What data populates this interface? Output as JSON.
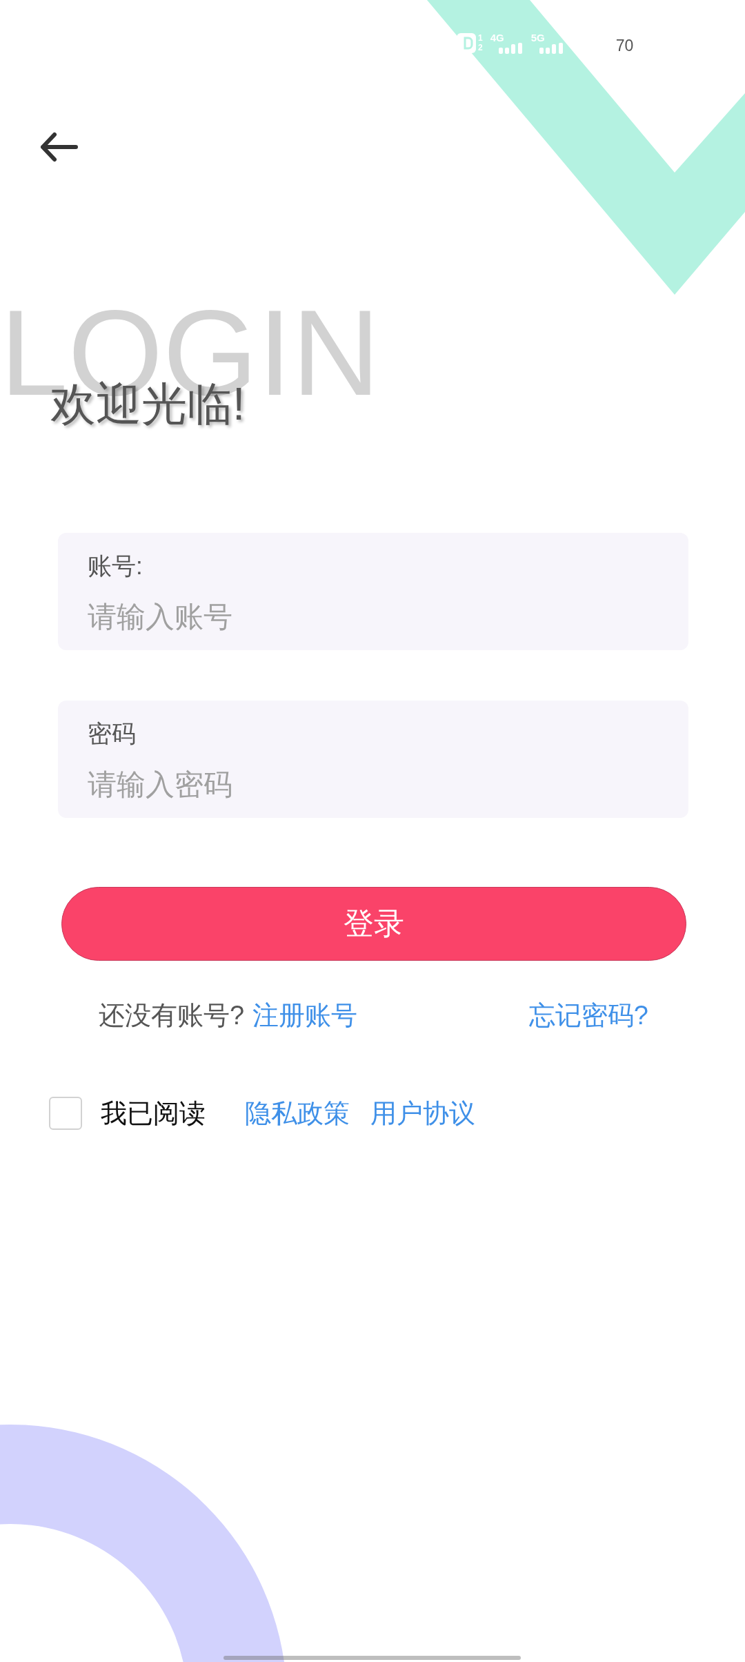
{
  "status_bar": {
    "sim_slots": [
      "1",
      "2"
    ],
    "networks": [
      {
        "label": "4G"
      },
      {
        "label": "5G"
      }
    ],
    "battery": "70"
  },
  "header": {
    "watermark": "LOGIN",
    "title": "欢迎光临!"
  },
  "form": {
    "fields": [
      {
        "label": "账号:",
        "placeholder": "请输入账号"
      },
      {
        "label": "密码",
        "placeholder": "请输入密码"
      }
    ],
    "submit": "登录"
  },
  "links": {
    "prompt": "还没有账号?",
    "register": "注册账号",
    "forgot": "忘记密码?"
  },
  "agreement": {
    "checked": false,
    "text": "我已阅读",
    "links": [
      "隐私政策",
      "用户协议"
    ]
  }
}
